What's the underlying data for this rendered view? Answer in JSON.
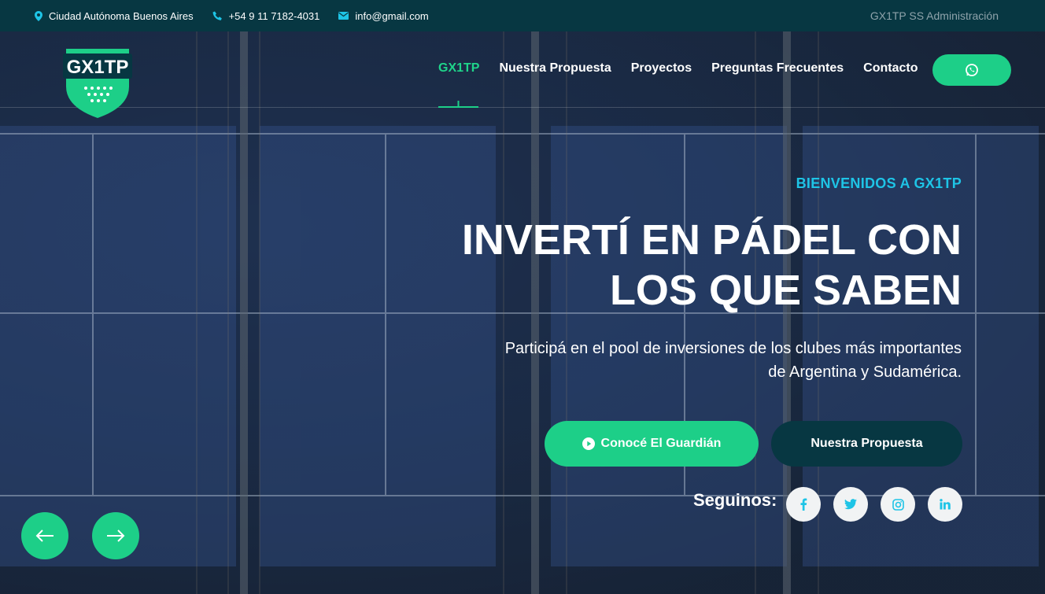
{
  "topbar": {
    "location": "Ciudad Autónoma Buenos Aires",
    "phone": "+54 9 11 7182-4031",
    "email": "info@gmail.com",
    "admin_link": "GX1TP SS Administración"
  },
  "brand": {
    "logo_text": "GX1TP",
    "accent": "#1dcf88",
    "dark": "#073742",
    "highlight": "#1ec4e6"
  },
  "nav": {
    "items": [
      {
        "label": "GX1TP",
        "active": true
      },
      {
        "label": "Nuestra Propuesta",
        "active": false
      },
      {
        "label": "Proyectos",
        "active": false
      },
      {
        "label": "Preguntas Frecuentes",
        "active": false
      },
      {
        "label": "Contacto",
        "active": false
      }
    ],
    "whatsapp_icon": "whatsapp-icon"
  },
  "hero": {
    "kicker": "BIENVENIDOS A GX1TP",
    "headline_line1": "INVERTÍ EN PÁDEL CON",
    "headline_line2": "LOS QUE SABEN",
    "subline_line1": "Participá en el pool de inversiones de los clubes más importantes",
    "subline_line2": "de Argentina y Sudamérica.",
    "primary_button": "Conocé El Guardián",
    "secondary_button": "Nuestra Propuesta",
    "follow_label": "Seguinos:",
    "social": [
      "facebook-icon",
      "twitter-icon",
      "instagram-icon",
      "linkedin-icon"
    ]
  },
  "slider": {
    "prev_icon": "arrow-left-icon",
    "next_icon": "arrow-right-icon"
  }
}
